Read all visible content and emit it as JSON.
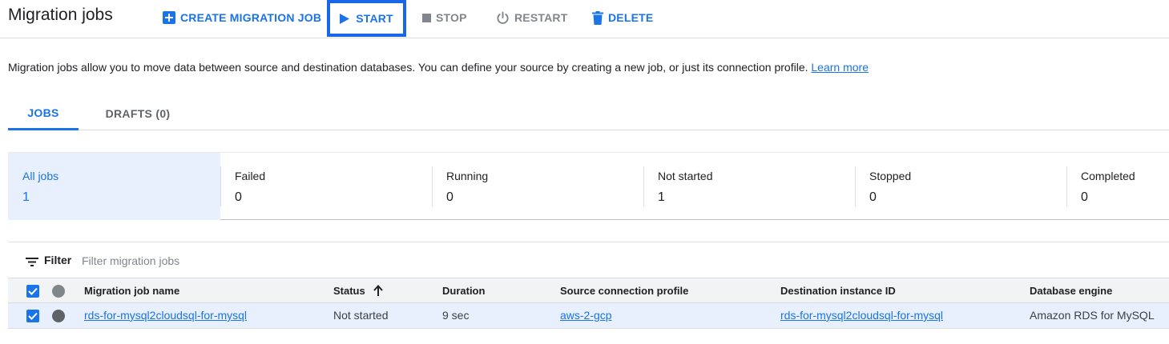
{
  "header": {
    "title": "Migration jobs",
    "create_label": "CREATE MIGRATION JOB",
    "start_label": "START",
    "stop_label": "STOP",
    "restart_label": "RESTART",
    "delete_label": "DELETE"
  },
  "description": {
    "text": "Migration jobs allow you to move data between source and destination databases. You can define your source by creating a new job, or just its connection profile.",
    "link": "Learn more"
  },
  "tabs": [
    {
      "label": "JOBS",
      "active": true
    },
    {
      "label": "DRAFTS (0)",
      "active": false
    }
  ],
  "summary": [
    {
      "label": "All jobs",
      "count": "1",
      "active": true
    },
    {
      "label": "Failed",
      "count": "0"
    },
    {
      "label": "Running",
      "count": "0"
    },
    {
      "label": "Not started",
      "count": "1"
    },
    {
      "label": "Stopped",
      "count": "0"
    },
    {
      "label": "Completed",
      "count": "0"
    }
  ],
  "filter": {
    "label": "Filter",
    "placeholder": "Filter migration jobs"
  },
  "table": {
    "columns": [
      "Migration job name",
      "Status",
      "Duration",
      "Source connection profile",
      "Destination instance ID",
      "Database engine"
    ],
    "rows": [
      {
        "name": "rds-for-mysql2cloudsql-for-mysql",
        "status": "Not started",
        "duration": "9 sec",
        "source": "aws-2-gcp",
        "destination": "rds-for-mysql2cloudsql-for-mysql",
        "engine": "Amazon RDS for MySQL"
      }
    ]
  },
  "colors": {
    "accent": "#1a73e8",
    "selected_bg": "#e8f0fe",
    "highlight_border": "#1a66e8"
  }
}
